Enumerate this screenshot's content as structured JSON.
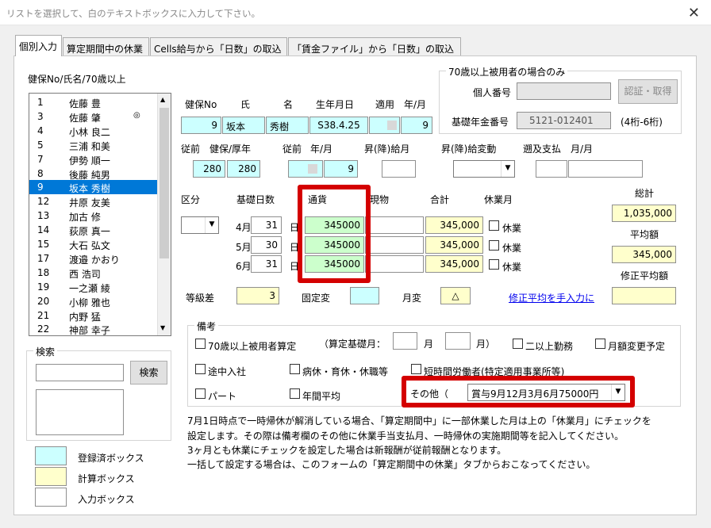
{
  "window": {
    "title": "リストを選択して、白のテキストボックスに入力して下さい。",
    "close_glyph": "✕"
  },
  "tabs": [
    {
      "label": "個別入力"
    },
    {
      "label": "算定期間中の休業"
    },
    {
      "label": "Cells給与から「日数」の取込"
    },
    {
      "label": "「賃金ファイル」から「日数」の取込"
    }
  ],
  "list": {
    "header": "健保No/氏名/70歳以上",
    "items": [
      {
        "no": "1",
        "name": "佐藤 豊",
        "mark": ""
      },
      {
        "no": "3",
        "name": "佐藤 肇",
        "mark": "◎"
      },
      {
        "no": "4",
        "name": "小林 良二",
        "mark": ""
      },
      {
        "no": "5",
        "name": "三浦 和美",
        "mark": ""
      },
      {
        "no": "7",
        "name": "伊勢 順一",
        "mark": ""
      },
      {
        "no": "8",
        "name": "後藤 純男",
        "mark": ""
      },
      {
        "no": "9",
        "name": "坂本 秀樹",
        "mark": ""
      },
      {
        "no": "12",
        "name": "井原 友美",
        "mark": ""
      },
      {
        "no": "13",
        "name": "加古 修",
        "mark": ""
      },
      {
        "no": "14",
        "name": "荻原 真一",
        "mark": ""
      },
      {
        "no": "15",
        "name": "大石 弘文",
        "mark": ""
      },
      {
        "no": "17",
        "name": "渡邉 かおり",
        "mark": ""
      },
      {
        "no": "18",
        "name": "西 浩司",
        "mark": ""
      },
      {
        "no": "19",
        "name": "一之瀬 綾",
        "mark": ""
      },
      {
        "no": "20",
        "name": "小柳 雅也",
        "mark": ""
      },
      {
        "no": "21",
        "name": "内野 猛",
        "mark": ""
      },
      {
        "no": "22",
        "name": "神部 幸子",
        "mark": ""
      }
    ],
    "selected_index": 6
  },
  "search": {
    "legend": "検索",
    "button": "検索",
    "input_value": "",
    "result_value": ""
  },
  "legend_boxes": {
    "registered": "登録済ボックス",
    "calculated": "計算ボックス",
    "input": "入力ボックス"
  },
  "over70": {
    "legend": "70歳以上被用者の場合のみ",
    "personal_number_label": "個人番号",
    "personal_number_value": "",
    "auth_button": "認証・取得",
    "pension_label": "基礎年金番号",
    "pension_value": "5121-012401",
    "pension_hint": "(4桁-6桁)"
  },
  "header_labels": {
    "no": "健保No",
    "sei": "氏",
    "mei": "名",
    "birth": "生年月日",
    "apply": "適用",
    "ym": "年/月"
  },
  "header_values": {
    "no": "9",
    "sei": "坂本",
    "mei": "秀樹",
    "birth": "S38.4.25",
    "apply_month": "9"
  },
  "prev_labels": {
    "prev": "従前",
    "kenpo_kosei": "健保/厚年",
    "prev2": "従前",
    "ym": "年/月",
    "raise_pay": "昇(降)給月",
    "raise_change": "昇(降)給変動",
    "retro": "遡及支払",
    "retro_ym": "月/月"
  },
  "prev_values": {
    "kenpo": "280",
    "kosei": "280",
    "prev_month": "9"
  },
  "pay_labels": {
    "kubun": "区分",
    "basedays": "基礎日数",
    "cash": "通貨",
    "inkind": "現物",
    "total": "合計",
    "leave": "休業月",
    "grand_total": "総計",
    "average": "平均額",
    "corrected_average": "修正平均額",
    "day_unit": "日",
    "leave_check": "休業"
  },
  "pay_rows": [
    {
      "month": "4月",
      "days": "31",
      "cash": "345000",
      "total": "345,000"
    },
    {
      "month": "5月",
      "days": "30",
      "cash": "345000",
      "total": "345,000"
    },
    {
      "month": "6月",
      "days": "31",
      "cash": "345000",
      "total": "345,000"
    }
  ],
  "totals": {
    "grand_total": "1,035,000",
    "average": "345,000"
  },
  "grade": {
    "label": "等級差",
    "value": "3",
    "fixed_change_label": "固定変",
    "month_change_label": "月変",
    "month_change_value": "△",
    "manual_link": "修正平均を手入力に"
  },
  "remarks": {
    "legend": "備考",
    "over70": "70歳以上被用者算定",
    "base_month_label": "（算定基礎月：",
    "month_unit": "月",
    "month_close": "月）",
    "two_work": "二以上勤務",
    "amount_change": "月額変更予定",
    "mid_join": "途中入社",
    "sick_leave": "病休・育休・休職等",
    "short_time": "短時間労働者(特定適用事業所等)",
    "part": "パート",
    "annual_avg": "年間平均",
    "other_label": "その他（",
    "other_value": "賞与9月12月3月6月75000円"
  },
  "notes": [
    "7月1日時点で一時帰休が解消している場合、「算定期間中」に一部休業した月は上の「休業月」にチェックを",
    "設定します。その際は備考欄のその他に休業手当支払月、一時帰休の実施期間等を記入してください。",
    "3ヶ月とも休業にチェックを設定した場合は新報酬が従前報酬となります。",
    "一括して設定する場合は、このフォームの「算定期間中の休業」タブからおこなってください。"
  ],
  "colors": {
    "registered": "#ccffff",
    "calculated": "#ffffcc",
    "highlight_cash": "#ccffcc",
    "annotation_red": "#d40000",
    "selection": "#0078d7"
  }
}
